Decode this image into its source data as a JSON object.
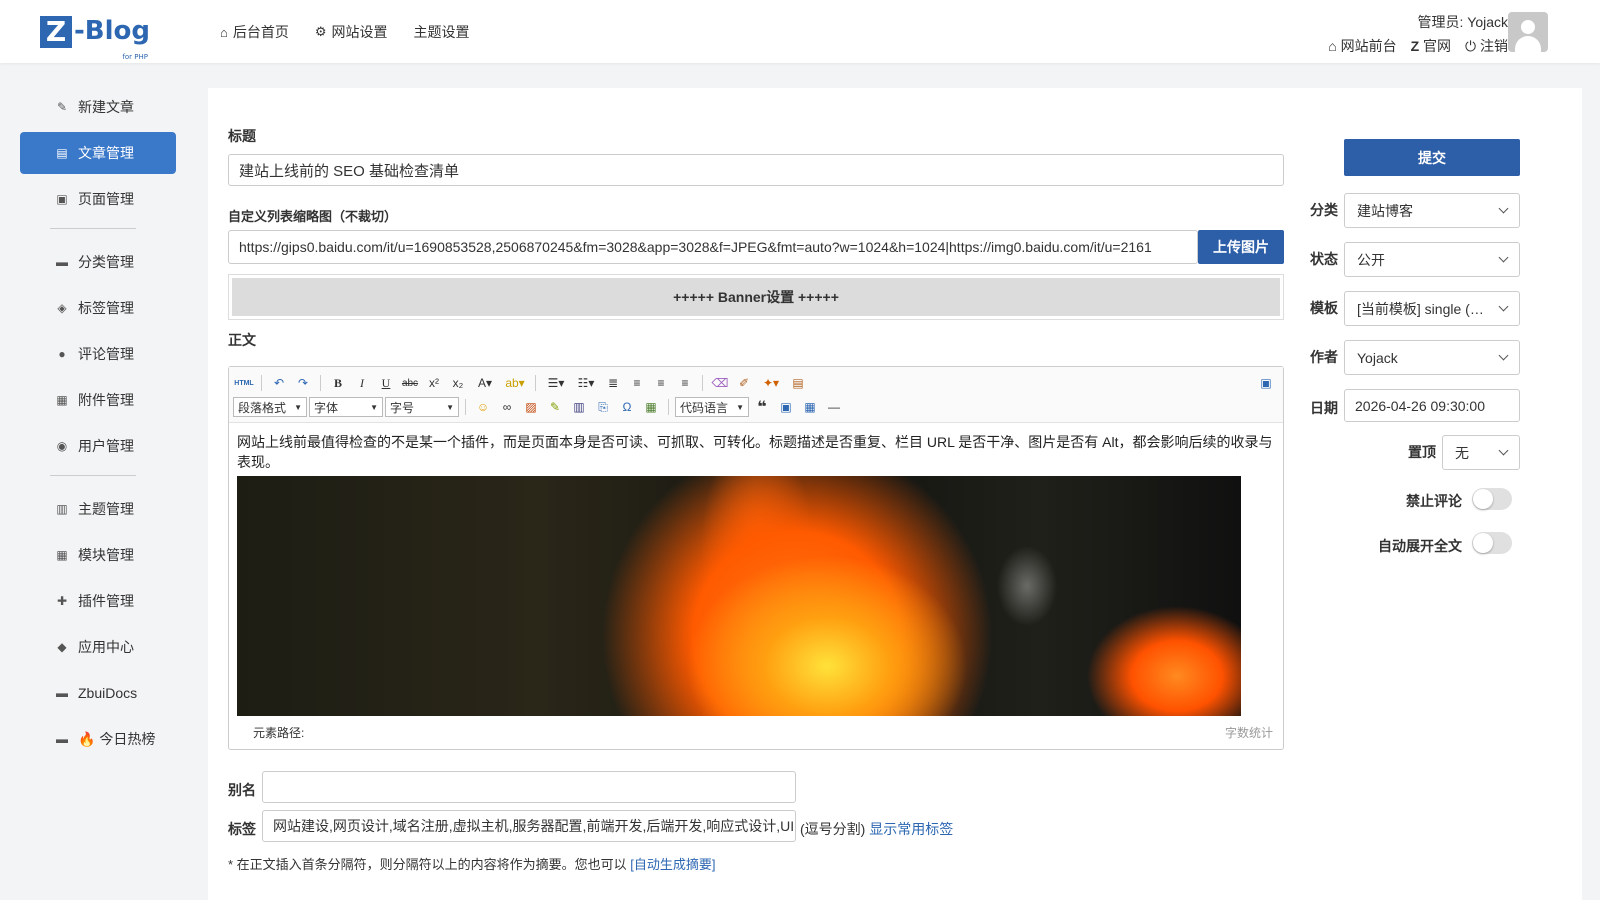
{
  "logo": {
    "letter": "Z",
    "name": "-Blog",
    "sub": "for PHP"
  },
  "topnav": [
    {
      "icon": "home-icon",
      "glyph": "⌂",
      "label": "后台首页"
    },
    {
      "icon": "gear-icon",
      "glyph": "⚙",
      "label": "网站设置"
    },
    {
      "icon": "",
      "glyph": "",
      "label": "主题设置"
    }
  ],
  "user": {
    "role_label": "管理员: Yojack",
    "links": [
      {
        "icon": "house-icon",
        "glyph": "⌂",
        "label": "网站前台"
      },
      {
        "icon": "zblog-icon",
        "glyph": "Z",
        "label": "官网"
      },
      {
        "icon": "power-icon",
        "glyph": "⏻",
        "label": "注销"
      }
    ]
  },
  "sidebar": {
    "items": [
      {
        "icon": "edit-icon",
        "glyph": "✎",
        "label": "新建文章",
        "active": false
      },
      {
        "icon": "article-icon",
        "glyph": "▤",
        "label": "文章管理",
        "active": true
      },
      {
        "icon": "page-icon",
        "glyph": "▣",
        "label": "页面管理",
        "active": false
      },
      {
        "icon": "folder-icon",
        "glyph": "▬",
        "label": "分类管理",
        "active": false
      },
      {
        "icon": "tag-icon",
        "glyph": "◈",
        "label": "标签管理",
        "active": false
      },
      {
        "icon": "comment-icon",
        "glyph": "●",
        "label": "评论管理",
        "active": false
      },
      {
        "icon": "attachment-icon",
        "glyph": "▦",
        "label": "附件管理",
        "active": false
      },
      {
        "icon": "users-icon",
        "glyph": "◉",
        "label": "用户管理",
        "active": false
      },
      {
        "icon": "theme-icon",
        "glyph": "▥",
        "label": "主题管理",
        "active": false
      },
      {
        "icon": "module-icon",
        "glyph": "▦",
        "label": "模块管理",
        "active": false
      },
      {
        "icon": "plugin-icon",
        "glyph": "✚",
        "label": "插件管理",
        "active": false
      },
      {
        "icon": "app-icon",
        "glyph": "◆",
        "label": "应用中心",
        "active": false
      },
      {
        "icon": "docs-icon",
        "glyph": "▬",
        "label": "ZbuiDocs",
        "active": false
      },
      {
        "icon": "hot-icon",
        "glyph": "▬",
        "label": "🔥 今日热榜",
        "active": false
      }
    ]
  },
  "form": {
    "title_label": "标题",
    "title_value": "建站上线前的 SEO 基础检查清单",
    "thumb_label": "自定义列表缩略图（不裁切）",
    "thumb_value": "https://gips0.baidu.com/it/u=1690853528,2506870245&fm=3028&app=3028&f=JPEG&fmt=auto?w=1024&h=1024|https://img0.baidu.com/it/u=2161",
    "upload_button": "上传图片",
    "banner_label": "+++++ Banner设置 +++++",
    "body_label": "正文",
    "alias_label": "别名",
    "alias_value": "",
    "tags_label": "标签",
    "tags_value": "网站建设,网页设计,域名注册,虚拟主机,服务器配置,前端开发,后端开发,响应式设计,UI",
    "tags_hint": "(逗号分割)",
    "tags_link": "显示常用标签",
    "note_text": "* 在正文插入首条分隔符，则分隔符以上的内容将作为摘要。您也可以",
    "note_link": "[自动生成摘要]"
  },
  "editor": {
    "toolbar": {
      "selects": [
        "段落格式",
        "字体",
        "字号",
        "代码语言"
      ],
      "html_label": "HTML"
    },
    "content_text": "网站上线前最值得检查的不是某一个插件，而是页面本身是否可读、可抓取、可转化。标题描述是否重复、栏目 URL 是否干净、图片是否有 Alt，都会影响后续的收录与表现。",
    "path_label": "元素路径:",
    "word_count_label": "字数统计"
  },
  "right": {
    "submit": "提交",
    "category_label": "分类",
    "category_value": "建站博客",
    "status_label": "状态",
    "status_value": "公开",
    "template_label": "模板",
    "template_value": "[当前模板] single (文章页)",
    "author_label": "作者",
    "author_value": "Yojack",
    "date_label": "日期",
    "date_value": "2026-04-26 09:30:00",
    "top_label": "置顶",
    "top_value": "无",
    "no_comment_label": "禁止评论",
    "no_comment_on": false,
    "auto_expand_label": "自动展开全文",
    "auto_expand_on": false
  },
  "colors": {
    "accent": "#2d5ea8",
    "active_nav": "#3a78c9",
    "brand": "#2d67b2"
  }
}
